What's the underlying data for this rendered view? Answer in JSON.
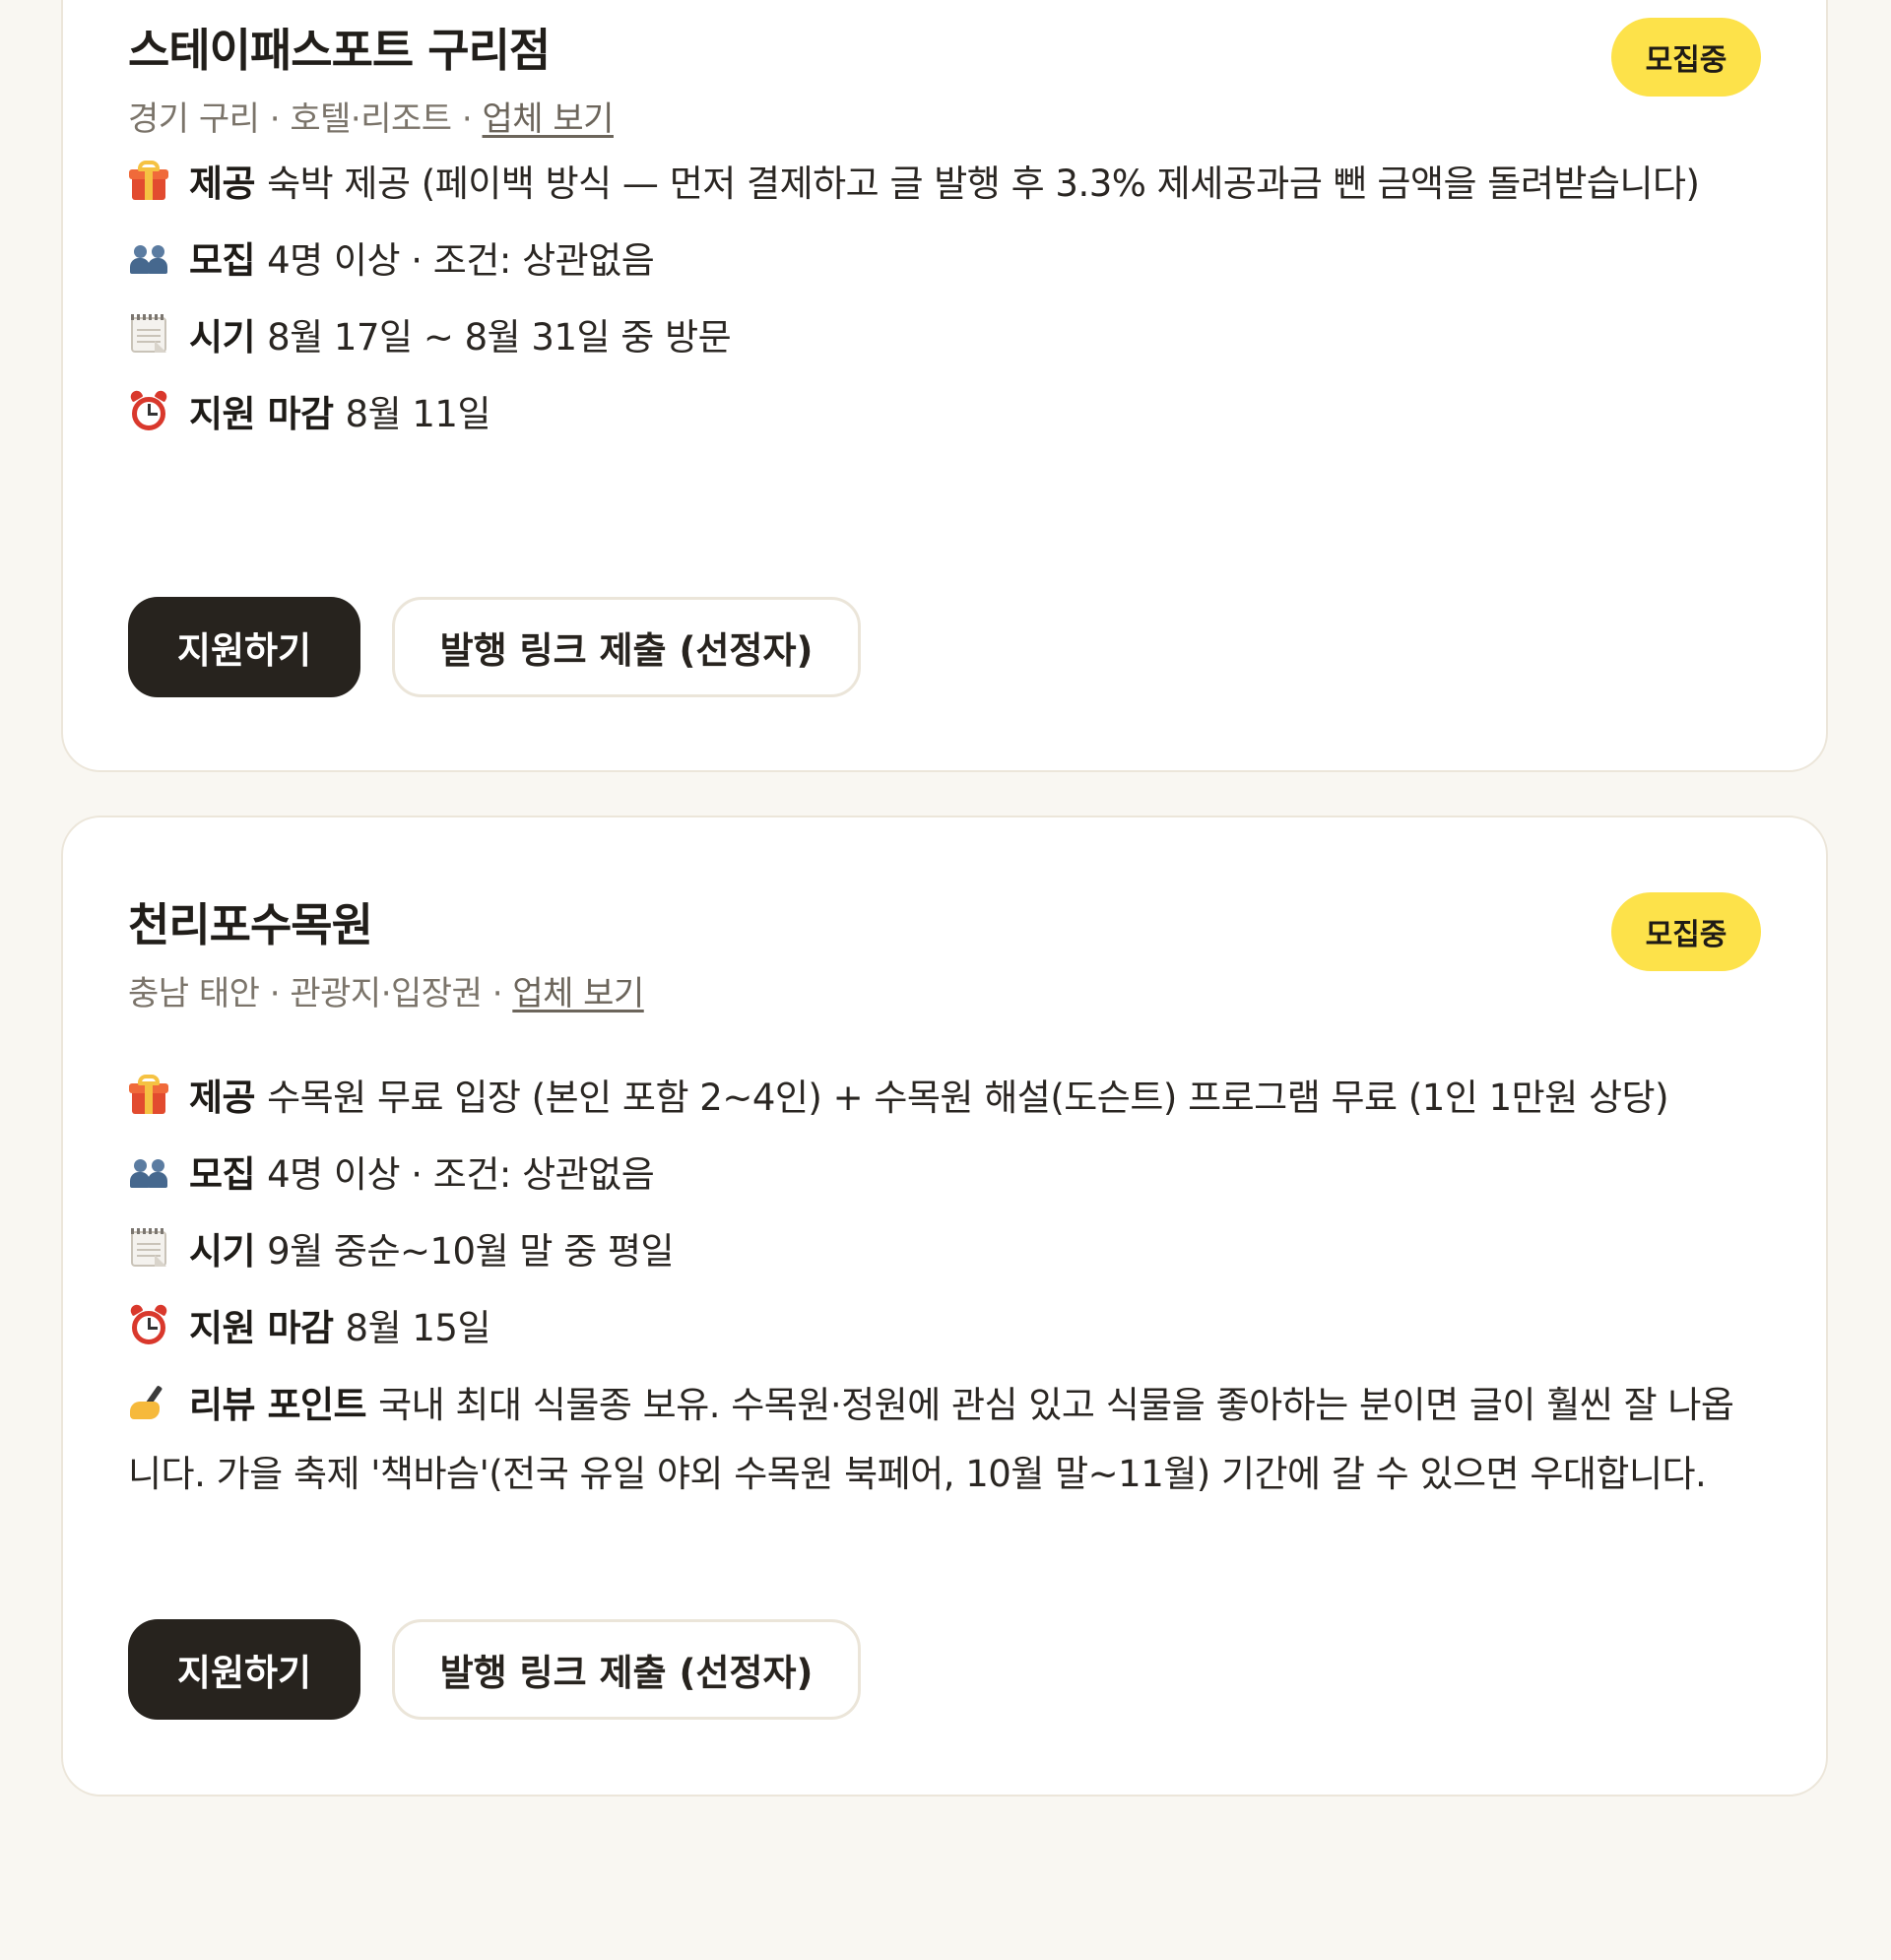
{
  "cards": [
    {
      "title": "스테이패스포트 구리점",
      "badge": "모집중",
      "meta": {
        "region": "경기 구리",
        "category": "호텔·리조트",
        "separator": "·",
        "vendor_link": "업체 보기"
      },
      "rows": {
        "offer": {
          "icon": "gift-icon",
          "label": "제공",
          "value": "숙박 제공 (페이백 방식 — 먼저 결제하고 글 발행 후 3.3% 제세공과금 뺀 금액을 돌려받습니다)"
        },
        "recruit": {
          "icon": "people-icon",
          "label": "모집",
          "value": "4명 이상 · 조건: 상관없음"
        },
        "period": {
          "icon": "calendar-icon",
          "label": "시기",
          "value": "8월 17일 ~ 8월 31일 중 방문"
        },
        "deadline": {
          "icon": "alarm-clock-icon",
          "label": "지원 마감",
          "value": "8월 11일"
        }
      },
      "buttons": {
        "apply": "지원하기",
        "submit": "발행 링크 제출 (선정자)"
      }
    },
    {
      "title": "천리포수목원",
      "badge": "모집중",
      "meta": {
        "region": "충남 태안",
        "category": "관광지·입장권",
        "separator": "·",
        "vendor_link": "업체 보기"
      },
      "rows": {
        "offer": {
          "icon": "gift-icon",
          "label": "제공",
          "value": "수목원 무료 입장 (본인 포함 2~4인) + 수목원 해설(도슨트) 프로그램 무료 (1인 1만원 상당)"
        },
        "recruit": {
          "icon": "people-icon",
          "label": "모집",
          "value": "4명 이상 · 조건: 상관없음"
        },
        "period": {
          "icon": "calendar-icon",
          "label": "시기",
          "value": "9월 중순~10월 말 중 평일"
        },
        "deadline": {
          "icon": "alarm-clock-icon",
          "label": "지원 마감",
          "value": "8월 15일"
        },
        "review": {
          "icon": "writing-hand-icon",
          "label": "리뷰 포인트",
          "value": "국내 최대 식물종 보유. 수목원·정원에 관심 있고 식물을 좋아하는 분이면 글이 훨씬 잘 나옵니다. 가을 축제 '책바슴'(전국 유일 야외 수목원 북페어, 10월 말~11월) 기간에 갈 수 있으면 우대합니다."
        }
      },
      "buttons": {
        "apply": "지원하기",
        "submit": "발행 링크 제출 (선정자)"
      }
    }
  ],
  "colors": {
    "page_bg": "#f9f7f2",
    "badge": "#fde24a",
    "primary_button": "#27231e"
  }
}
